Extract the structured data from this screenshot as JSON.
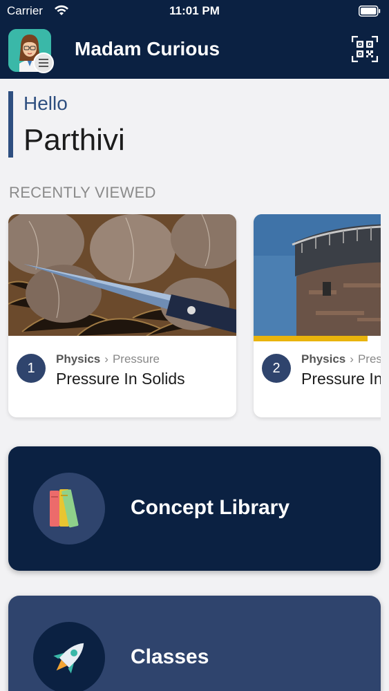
{
  "status_bar": {
    "carrier": "Carrier",
    "time": "11:01 PM"
  },
  "header": {
    "title": "Madam Curious"
  },
  "greeting": {
    "hello": "Hello",
    "name": "Parthivi"
  },
  "recent": {
    "heading": "RECENTLY VIEWED",
    "cards": [
      {
        "index": "1",
        "subject": "Physics",
        "topic": "Pressure",
        "title": "Pressure In Solids",
        "progress": 0
      },
      {
        "index": "2",
        "subject": "Physics",
        "topic": "Pressure",
        "title": "Pressure In Liquids",
        "progress": 0.6
      }
    ]
  },
  "tiles": {
    "concept_library": "Concept Library",
    "classes": "Classes"
  },
  "colors": {
    "navy": "#0b2142",
    "slate": "#2f446d",
    "accent": "#e9b40d",
    "greeting": "#2e4f80"
  },
  "icons": [
    "wifi-icon",
    "battery-icon",
    "teacher-avatar-icon",
    "menu-icon",
    "qr-code-icon",
    "books-icon",
    "rocket-icon"
  ]
}
